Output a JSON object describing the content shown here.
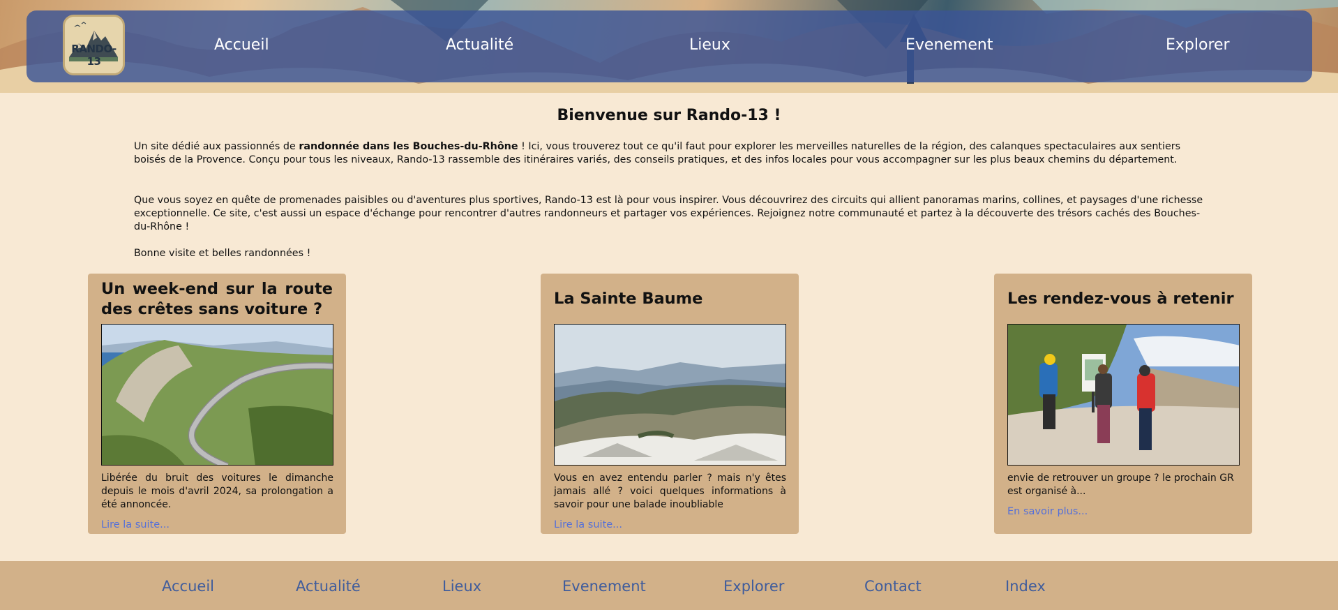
{
  "brand": {
    "logo_text": "RANDO-13"
  },
  "nav": {
    "items": [
      "Accueil",
      "Actualité",
      "Lieux",
      "Evenement",
      "Explorer"
    ]
  },
  "intro": {
    "title": "Bienvenue sur Rando-13 !",
    "p1_before": "Un site dédié aux passionnés de ",
    "p1_bold": "randonnée dans les Bouches-du-Rhône",
    "p1_after": " ! Ici, vous trouverez tout ce qu'il faut pour explorer les merveilles naturelles de la région, des calanques spectaculaires aux sentiers boisés de la Provence. Conçu pour tous les niveaux, Rando-13 rassemble des itinéraires variés, des conseils pratiques, et des infos locales pour vous accompagner sur les plus beaux chemins du département.",
    "p2": "Que vous soyez en quête de promenades paisibles ou d'aventures plus sportives, Rando-13 est là pour vous inspirer. Vous découvrirez des circuits qui allient panoramas marins, collines, et paysages d'une richesse exceptionnelle. Ce site, c'est aussi un espace d'échange pour rencontrer d'autres randonneurs et partager vos expériences. Rejoignez notre communauté et partez à la découverte des trésors cachés des Bouches-du-Rhône !",
    "p3": "Bonne visite et belles randonnées !"
  },
  "cards": [
    {
      "title": "Un week-end sur la route des crêtes sans voiture ?",
      "text": "Libérée du bruit des voitures le dimanche depuis le mois d'avril 2024, sa prolongation a été annoncée.",
      "link": "Lire la suite..."
    },
    {
      "title": "La Sainte Baume",
      "text": "Vous en avez entendu parler ? mais n'y êtes jamais allé ? voici quelques informations à savoir pour une balade inoubliable",
      "link": "Lire la suite..."
    },
    {
      "title": "Les rendez-vous à retenir",
      "text": "envie de retrouver un groupe ? le prochain GR est organisé à...",
      "link": "En savoir plus..."
    }
  ],
  "footer": {
    "items": [
      "Accueil",
      "Actualité",
      "Lieux",
      "Evenement",
      "Explorer",
      "Contact",
      "Index"
    ]
  },
  "colors": {
    "page_bg": "#f8e9d4",
    "nav_bar": "#3a5496",
    "card_bg": "#d2b189",
    "link": "#5570d8",
    "footer_link": "#3f5c9c"
  }
}
